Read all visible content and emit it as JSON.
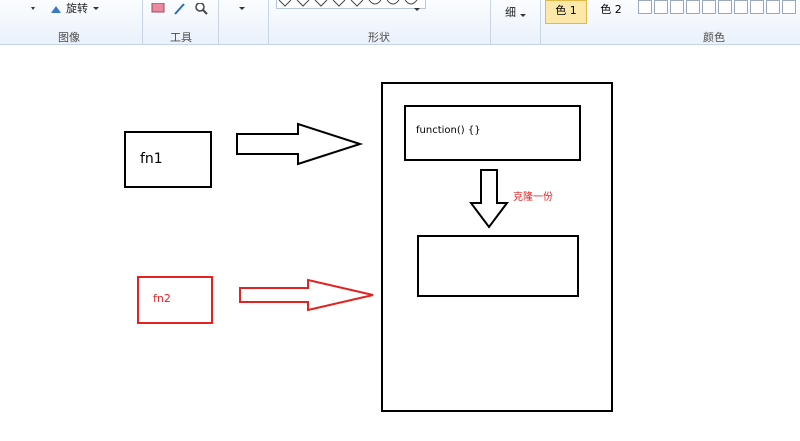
{
  "ribbon": {
    "rotate_label": "旋转",
    "image_group": "图像",
    "tools_group": "工具",
    "shapes_group": "形状",
    "size_label": "细",
    "color1_label": "色 1",
    "color2_label": "色 2",
    "colors_group": "颜色"
  },
  "canvas": {
    "box_fn1": "fn1",
    "box_fn2": "fn2",
    "function_box": "function() {}",
    "clone_note": "克隆一份",
    "colors": {
      "black": "#000000",
      "red": "#e32222"
    }
  }
}
